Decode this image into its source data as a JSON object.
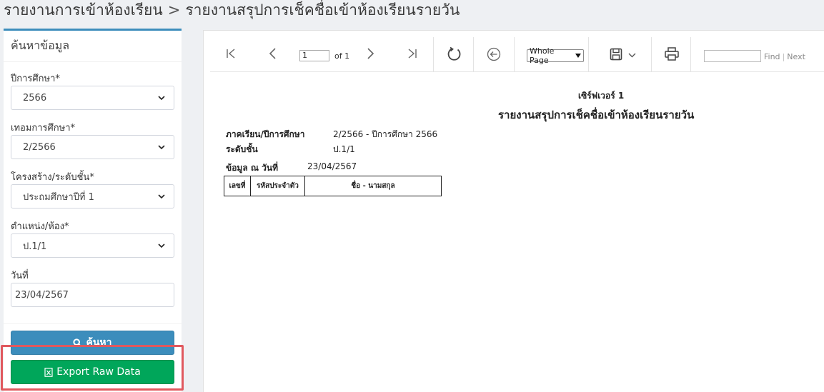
{
  "breadcrumb": {
    "parent": "รายงานการเข้าห้องเรียน",
    "separator": ">",
    "current": "รายงานสรุปการเช็คชื่อเข้าห้องเรียนรายวัน"
  },
  "search_panel": {
    "title": "ค้นหาข้อมูล",
    "year_label": "ปีการศึกษา*",
    "year_value": "2566",
    "term_label": "เทอมการศึกษา*",
    "term_value": "2/2566",
    "structure_label": "โครงสร้าง/ระดับชั้น*",
    "structure_value": "ประถมศึกษาปีที่ 1",
    "room_label": "ตำแหน่ง/ห้อง*",
    "room_value": "ป.1/1",
    "date_label": "วันที่",
    "date_value": "23/04/2567",
    "search_button": "ค้นหา",
    "export_button": "Export Raw Data"
  },
  "viewer_toolbar": {
    "page_value": "1",
    "page_of": "of 1",
    "zoom_value": "Whole Page",
    "find_label": "Find",
    "next_label": "Next",
    "find_separator": "|"
  },
  "report": {
    "server": "เซิร์ฟเวอร์ 1",
    "title": "รายงานสรุปการเช็คชื่อเข้าห้องเรียนรายวัน",
    "term_label": "ภาคเรียน/ปีการศึกษา",
    "term_value": "2/2566 - ปีการศึกษา 2566",
    "level_label": "ระดับชั้น",
    "level_value": "ป.1/1",
    "date_label": "ข้อมูล ณ วันที่",
    "date_value": "23/04/2567",
    "columns": [
      "เลขที่",
      "รหัสประจำตัว",
      "ชื่อ - นามสกุล"
    ]
  },
  "colors": {
    "primary": "#3c8dbc",
    "success": "#00a65a",
    "highlight": "#e0585e"
  }
}
